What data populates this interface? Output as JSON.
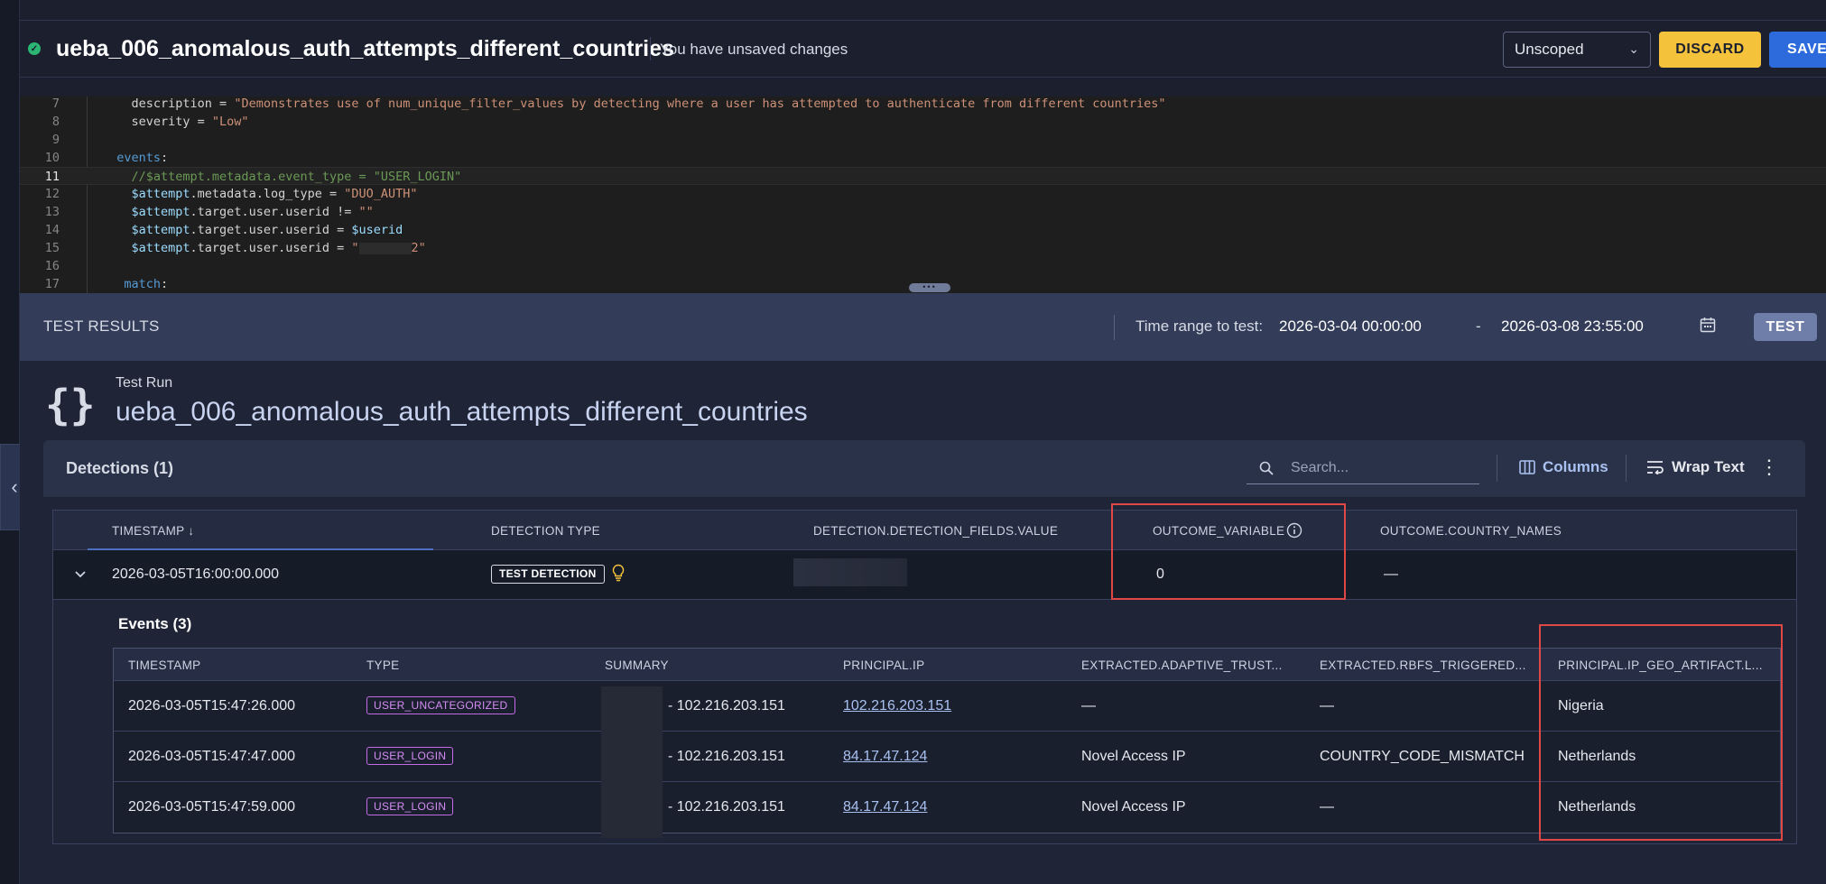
{
  "header": {
    "rule_title": "ueba_006_anomalous_auth_attempts_different_countries",
    "unsaved_text": "You have unsaved changes",
    "scope_value": "Unscoped",
    "discard_label": "DISCARD",
    "save_label": "SAVE"
  },
  "editor": {
    "lines": [
      {
        "n": "7",
        "segments": [
          [
            "plain",
            "    description = "
          ],
          [
            "str",
            "\"Demonstrates use of num_unique_filter_values by detecting where a user has attempted to authenticate from different countries\""
          ]
        ]
      },
      {
        "n": "8",
        "segments": [
          [
            "plain",
            "    severity = "
          ],
          [
            "str",
            "\"Low\""
          ]
        ]
      },
      {
        "n": "9",
        "segments": []
      },
      {
        "n": "10",
        "segments": [
          [
            "plain",
            "  "
          ],
          [
            "key",
            "events"
          ],
          [
            "plain",
            ":"
          ]
        ]
      },
      {
        "n": "11",
        "active": true,
        "segments": [
          [
            "com",
            "    //$attempt.metadata.event_type = \"USER_LOGIN\""
          ]
        ]
      },
      {
        "n": "12",
        "segments": [
          [
            "var",
            "    $attempt"
          ],
          [
            "plain",
            ".metadata.log_type = "
          ],
          [
            "str",
            "\"DUO_AUTH\""
          ]
        ]
      },
      {
        "n": "13",
        "segments": [
          [
            "var",
            "    $attempt"
          ],
          [
            "plain",
            ".target.user.userid != "
          ],
          [
            "str",
            "\"\""
          ]
        ]
      },
      {
        "n": "14",
        "segments": [
          [
            "var",
            "    $attempt"
          ],
          [
            "plain",
            ".target.user.userid = "
          ],
          [
            "var",
            "$userid"
          ]
        ]
      },
      {
        "n": "15",
        "segments": [
          [
            "var",
            "    $attempt"
          ],
          [
            "plain",
            ".target.user.userid = "
          ],
          [
            "str",
            "\""
          ],
          [
            "redact",
            ""
          ],
          [
            "str",
            "2\""
          ]
        ]
      },
      {
        "n": "16",
        "segments": []
      },
      {
        "n": "17",
        "segments": [
          [
            "plain",
            "   "
          ],
          [
            "key",
            "match"
          ],
          [
            "plain",
            ":"
          ]
        ]
      }
    ]
  },
  "results_bar": {
    "label": "TEST RESULTS",
    "time_range_label": "Time range to test:",
    "start": "2026-03-04 00:00:00",
    "dash": "-",
    "end": "2026-03-08 23:55:00",
    "test_label": "TEST"
  },
  "test_run": {
    "label": "Test Run",
    "title": "ueba_006_anomalous_auth_attempts_different_countries"
  },
  "detections": {
    "title": "Detections (1)",
    "search_placeholder": "Search...",
    "columns_label": "Columns",
    "wrap_label": "Wrap Text",
    "headers": {
      "timestamp": "TIMESTAMP ↓",
      "detection_type": "DETECTION TYPE",
      "fields_value": "DETECTION.DETECTION_FIELDS.VALUE",
      "outcome_variable": "OUTCOME_VARIABLE",
      "country_names": "OUTCOME.COUNTRY_NAMES"
    },
    "row": {
      "timestamp": "2026-03-05T16:00:00.000",
      "type_badge": "TEST DETECTION",
      "outcome_variable": "0",
      "country_names": "—"
    }
  },
  "events": {
    "title": "Events (3)",
    "headers": {
      "timestamp": "TIMESTAMP",
      "type": "TYPE",
      "summary": "SUMMARY",
      "principal_ip": "PRINCIPAL.IP",
      "adaptive": "EXTRACTED.ADAPTIVE_TRUST...",
      "rbfs": "EXTRACTED.RBFS_TRIGGERED...",
      "geo": "PRINCIPAL.IP_GEO_ARTIFACT.L..."
    },
    "rows": [
      {
        "timestamp": "2026-03-05T15:47:26.000",
        "type": "USER_UNCATEGORIZED",
        "summary": "- 102.216.203.151",
        "principal_ip": "102.216.203.151",
        "adaptive": "—",
        "rbfs": "—",
        "geo": "Nigeria"
      },
      {
        "timestamp": "2026-03-05T15:47:47.000",
        "type": "USER_LOGIN",
        "summary": "- 102.216.203.151",
        "principal_ip": "84.17.47.124",
        "adaptive": "Novel Access IP",
        "rbfs": "COUNTRY_CODE_MISMATCH",
        "geo": "Netherlands"
      },
      {
        "timestamp": "2026-03-05T15:47:59.000",
        "type": "USER_LOGIN",
        "summary": "- 102.216.203.151",
        "principal_ip": "84.17.47.124",
        "adaptive": "Novel Access IP",
        "rbfs": "—",
        "geo": "Netherlands"
      }
    ]
  },
  "colors": {
    "accent_blue": "#2d6bdc",
    "discard_yellow": "#f5c33b",
    "highlight_red": "#e04848",
    "badge_purple": "#c26be5",
    "status_green": "#2bb673"
  }
}
